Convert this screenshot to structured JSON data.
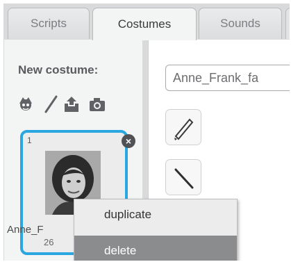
{
  "tabs": {
    "scripts": "Scripts",
    "costumes": "Costumes",
    "sounds": "Sounds"
  },
  "costume_pane": {
    "new_costume_label": "New costume:",
    "tools": [
      "character-icon",
      "paintbrush-icon",
      "upload-icon",
      "camera-icon"
    ],
    "costume": {
      "number": "1",
      "name": "Anne_Frank",
      "name_visible": "Anne_F",
      "size": "26",
      "selected_color": "#2aa6e0"
    }
  },
  "editor": {
    "name_field_value": "Anne_Frank_fa",
    "tools": [
      "brush-icon",
      "line-icon"
    ]
  },
  "context_menu": {
    "items": [
      "duplicate",
      "delete"
    ],
    "highlighted": "delete"
  }
}
